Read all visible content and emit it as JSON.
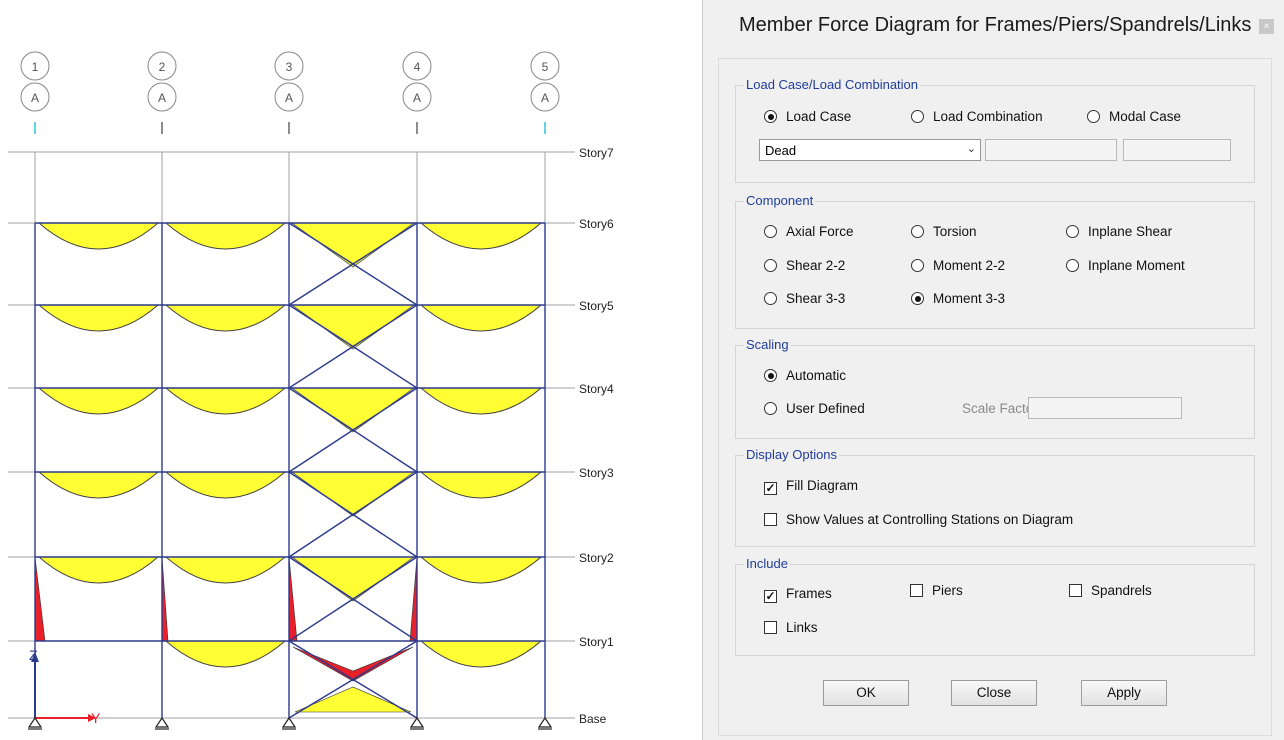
{
  "dialog": {
    "title": "Member Force Diagram for Frames/Piers/Spandrels/Links",
    "close_glyph": "×",
    "load": {
      "legend": "Load Case/Load Combination",
      "load_case": "Load Case",
      "load_combination": "Load Combination",
      "modal_case": "Modal Case",
      "selected": "Load Case",
      "dropdown_value": "Dead"
    },
    "component": {
      "legend": "Component",
      "axial_force": "Axial Force",
      "torsion": "Torsion",
      "inplane_shear": "Inplane Shear",
      "shear_22": "Shear 2-2",
      "moment_22": "Moment 2-2",
      "inplane_moment": "Inplane Moment",
      "shear_33": "Shear 3-3",
      "moment_33": "Moment 3-3",
      "selected": "Moment 3-3"
    },
    "scaling": {
      "legend": "Scaling",
      "automatic": "Automatic",
      "user_defined": "User Defined",
      "scale_factor": "Scale Factor",
      "selected": "Automatic"
    },
    "display": {
      "legend": "Display Options",
      "fill_diagram": "Fill Diagram",
      "fill_checked": true,
      "show_values": "Show Values at Controlling Stations on Diagram",
      "show_values_checked": false
    },
    "include": {
      "legend": "Include",
      "frames": "Frames",
      "frames_checked": true,
      "piers": "Piers",
      "spandrels": "Spandrels",
      "links": "Links"
    },
    "buttons": {
      "ok": "OK",
      "close": "Close",
      "apply": "Apply"
    }
  },
  "structure": {
    "grid_numbers": [
      "1",
      "2",
      "3",
      "4",
      "5"
    ],
    "grid_letter": "A",
    "stories": [
      "Story7",
      "Story6",
      "Story5",
      "Story4",
      "Story3",
      "Story2",
      "Story1",
      "Base"
    ],
    "axis_z": "Z",
    "axis_y": "Y",
    "colors": {
      "diagram_fill": "#ffff33",
      "negative_fill": "#e8202a",
      "frame_line": "#2c3a8c",
      "grid_line": "#a0a0a0"
    }
  }
}
